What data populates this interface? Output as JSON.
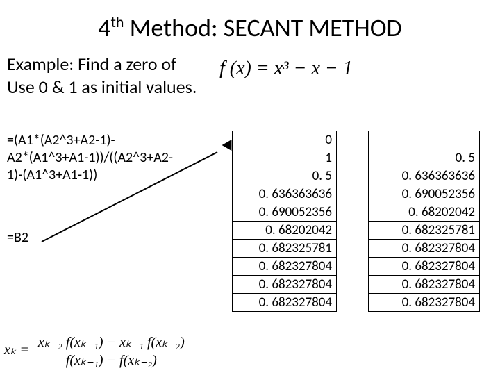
{
  "title_pre": "4",
  "title_sup": "th",
  "title_post": " Method: SECANT METHOD",
  "tagline_l1": "Example: Find a zero of",
  "tagline_l2": "Use 0 & 1 as initial values.",
  "fn_expr": "f (x) = x³ − x − 1",
  "formula_lines": [
    "=(A1*(A2^3+A2-1)-",
    "A2*(A1^3+A1-1))/((A2^3+A2-",
    "1)-(A1^3+A1-1))"
  ],
  "formula_b2": "=B2",
  "recurrence": {
    "lhs": "xₖ =",
    "num": "xₖ₋₂ f(xₖ₋₁) − xₖ₋₁ f(xₖ₋₂)",
    "den": "f(xₖ₋₁) − f(xₖ₋₂)"
  },
  "col_a": [
    "0",
    "1",
    "0. 5",
    "0. 636363636",
    "0. 690052356",
    "0. 68202042",
    "0. 682325781",
    "0. 682327804",
    "0. 682327804",
    "0. 682327804"
  ],
  "col_b": [
    "",
    "0. 5",
    "0. 636363636",
    "0. 690052356",
    "0. 68202042",
    "0. 682325781",
    "0. 682327804",
    "0. 682327804",
    "0. 682327804",
    "0. 682327804"
  ]
}
